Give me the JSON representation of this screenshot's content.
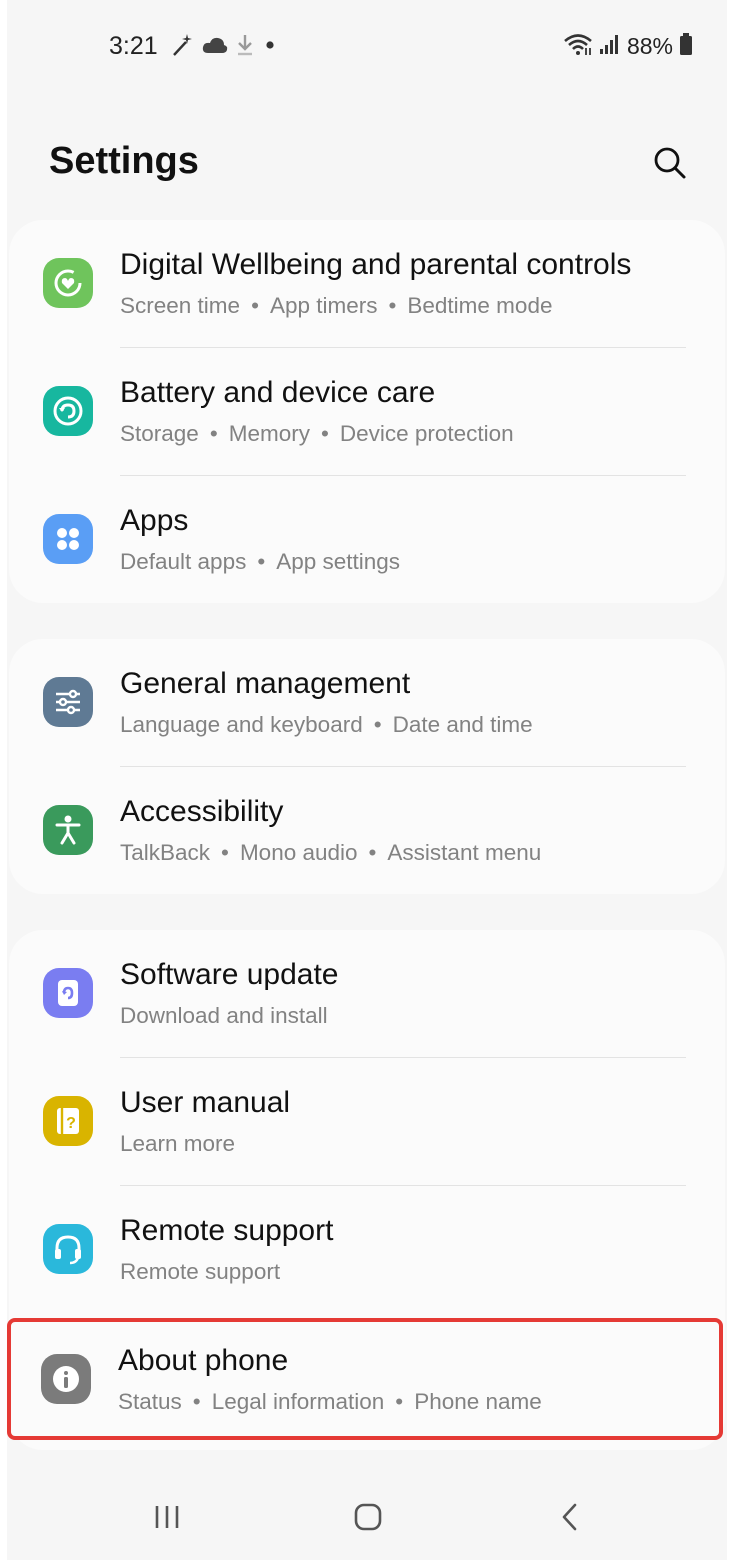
{
  "status_bar": {
    "time": "3:21",
    "battery_percent": "88%",
    "left_icons": [
      "magic-wand-icon",
      "cloud-icon",
      "download-icon",
      "notification-dot-icon"
    ],
    "right_icons": [
      "wifi-icon",
      "signal-icon",
      "battery-icon"
    ]
  },
  "header": {
    "title": "Settings",
    "search_icon": "search-icon"
  },
  "groups": [
    [
      {
        "id": "digital-wellbeing",
        "title": "Digital Wellbeing and parental controls",
        "subs": [
          "Screen time",
          "App timers",
          "Bedtime mode"
        ],
        "icon": "digital-wellbeing-icon",
        "color": "#6fc45c"
      },
      {
        "id": "battery-device-care",
        "title": "Battery and device care",
        "subs": [
          "Storage",
          "Memory",
          "Device protection"
        ],
        "icon": "device-care-icon",
        "color": "#17b79f"
      },
      {
        "id": "apps",
        "title": "Apps",
        "subs": [
          "Default apps",
          "App settings"
        ],
        "icon": "apps-icon",
        "color": "#5a9ef5"
      }
    ],
    [
      {
        "id": "general-management",
        "title": "General management",
        "subs": [
          "Language and keyboard",
          "Date and time"
        ],
        "icon": "sliders-icon",
        "color": "#5f7a94"
      },
      {
        "id": "accessibility",
        "title": "Accessibility",
        "subs": [
          "TalkBack",
          "Mono audio",
          "Assistant menu"
        ],
        "icon": "accessibility-icon",
        "color": "#3a9a5c"
      }
    ],
    [
      {
        "id": "software-update",
        "title": "Software update",
        "subs": [
          "Download and install"
        ],
        "icon": "software-update-icon",
        "color": "#7a7df1"
      },
      {
        "id": "user-manual",
        "title": "User manual",
        "subs": [
          "Learn more"
        ],
        "icon": "user-manual-icon",
        "color": "#d9b400"
      },
      {
        "id": "remote-support",
        "title": "Remote support",
        "subs": [
          "Remote support"
        ],
        "icon": "headset-icon",
        "color": "#2ab8db"
      },
      {
        "id": "about-phone",
        "title": "About phone",
        "subs": [
          "Status",
          "Legal information",
          "Phone name"
        ],
        "icon": "info-icon",
        "color": "#7b7b7b"
      }
    ]
  ],
  "highlight_color": "#e53a35",
  "nav": [
    "recents-button",
    "home-button",
    "back-button"
  ]
}
